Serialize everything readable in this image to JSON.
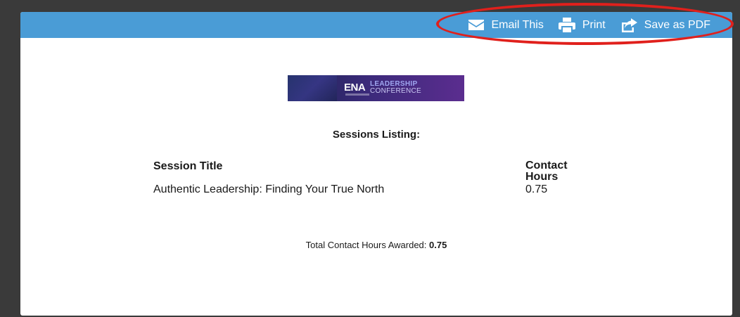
{
  "toolbar": {
    "email_label": "Email This",
    "print_label": "Print",
    "pdf_label": "Save as PDF",
    "background_color": "#4a9cd6"
  },
  "annotation": {
    "color": "#e0201c"
  },
  "banner": {
    "logo_text": "ENA",
    "logo_line1": "LEADERSHIP",
    "logo_line2": "CONFERENCE"
  },
  "listing": {
    "heading": "Sessions Listing:",
    "columns": {
      "title": "Session Title",
      "hours": "Contact Hours"
    },
    "rows": [
      {
        "title": "Authentic Leadership: Finding Your True North",
        "hours": "0.75"
      }
    ],
    "total_label": "Total Contact Hours Awarded:",
    "total_value": "0.75"
  },
  "icons": {
    "email": "envelope-icon",
    "print": "printer-icon",
    "pdf": "share-icon"
  }
}
